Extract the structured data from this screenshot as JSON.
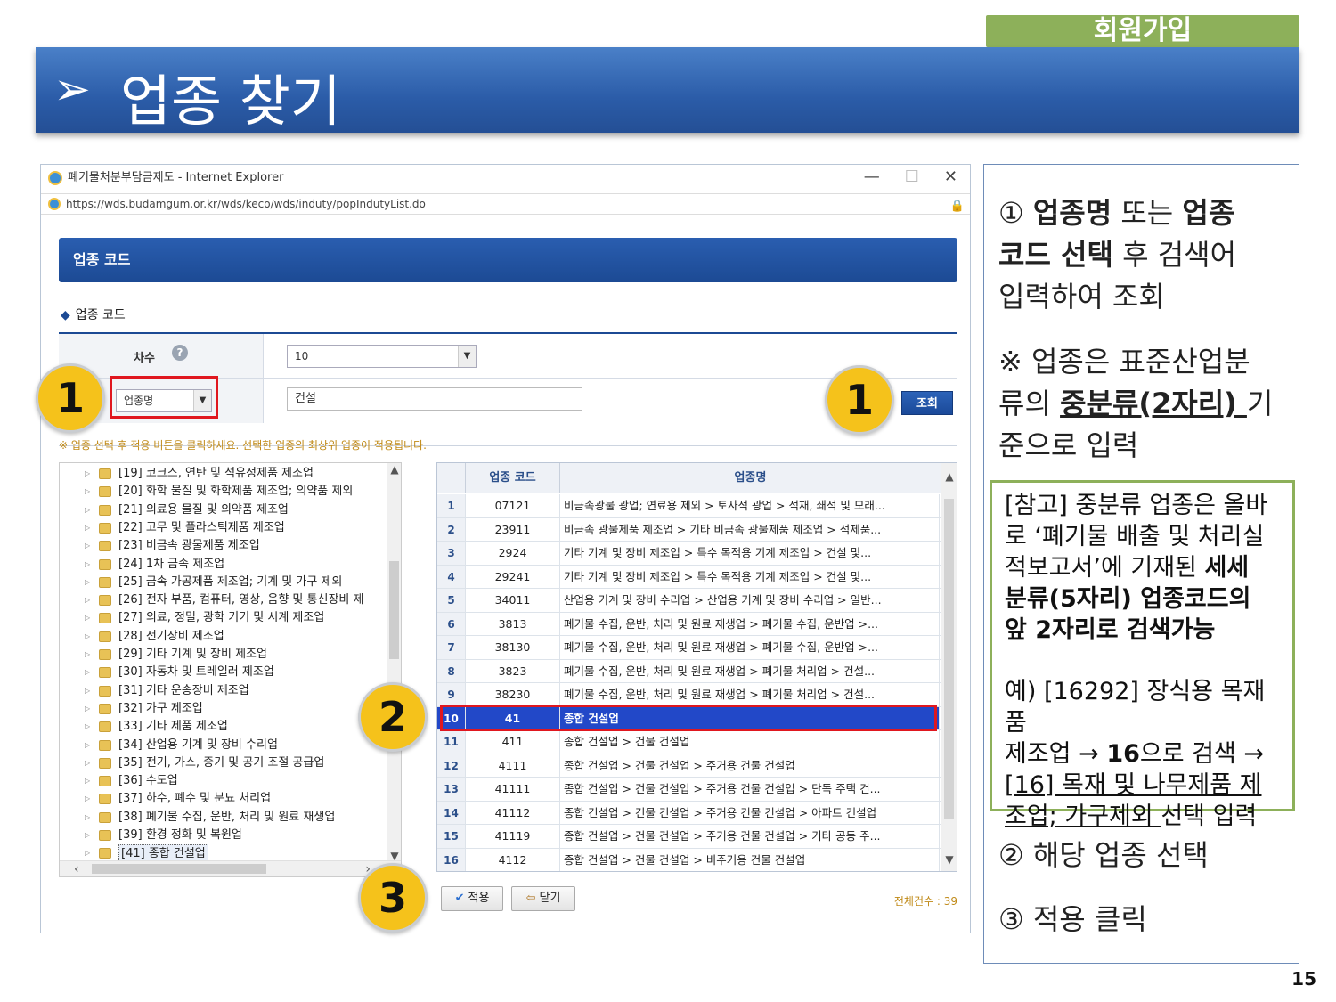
{
  "slide": {
    "badge": "회원가입",
    "arrow": "➢",
    "title": "업종 찾기",
    "page_number": "15"
  },
  "browser": {
    "window_title": "폐기물처분부담금제도 - Internet Explorer",
    "url": "https://wds.budamgum.or.kr/wds/keco/wds/induty/popIndutyList.do",
    "minimize": "—",
    "maximize": "☐",
    "close": "✕"
  },
  "popup": {
    "header": "업종 코드",
    "section_label": "업종 코드",
    "form": {
      "round_label": "차수",
      "round_value": "10",
      "type_select": "업종명",
      "search_value": "건설",
      "search_button": "조회"
    },
    "notice": "※ 업종 선택 후 적용 버튼을 클릭하세요. 선택한 업종의 최상위 업종이 적용됩니다.",
    "tree": [
      "[19] 코크스, 연탄 및 석유정제품 제조업",
      "[20] 화학 물질 및 화학제품 제조업; 의약품 제외",
      "[21] 의료용 물질 및 의약품 제조업",
      "[22] 고무 및 플라스틱제품 제조업",
      "[23] 비금속 광물제품 제조업",
      "[24] 1차 금속 제조업",
      "[25] 금속 가공제품 제조업; 기계 및 가구 제외",
      "[26] 전자 부품, 컴퓨터, 영상, 음향 및 통신장비 제",
      "[27] 의료, 정밀, 광학 기기 및 시계 제조업",
      "[28] 전기장비 제조업",
      "[29] 기타 기계 및 장비 제조업",
      "[30] 자동차 및 트레일러 제조업",
      "[31] 기타 운송장비 제조업",
      "[32] 가구 제조업",
      "[33] 기타 제품 제조업",
      "[34] 산업용 기계 및 장비 수리업",
      "[35] 전기, 가스, 증기 및 공기 조절 공급업",
      "[36] 수도업",
      "[37] 하수, 폐수 및 분뇨 처리업",
      "[38] 폐기물 수집, 운반, 처리 및 원료 재생업",
      "[39] 환경 정화 및 복원업",
      "[41] 종합 건설업"
    ],
    "grid": {
      "headers": [
        "",
        "업종 코드",
        "업종명"
      ],
      "rows": [
        {
          "no": "1",
          "code": "07121",
          "name": "비금속광물 광업; 연료용 제외 > 토사석 광업 > 석재, 쇄석 및 모래..."
        },
        {
          "no": "2",
          "code": "23911",
          "name": "비금속 광물제품 제조업 > 기타 비금속 광물제품 제조업 > 석제품..."
        },
        {
          "no": "3",
          "code": "2924",
          "name": "기타 기계 및 장비 제조업 > 특수 목적용 기계 제조업 > 건설 및..."
        },
        {
          "no": "4",
          "code": "29241",
          "name": "기타 기계 및 장비 제조업 > 특수 목적용 기계 제조업 > 건설 및..."
        },
        {
          "no": "5",
          "code": "34011",
          "name": "산업용 기계 및 장비 수리업 > 산업용 기계 및 장비 수리업 > 일반..."
        },
        {
          "no": "6",
          "code": "3813",
          "name": "폐기물 수집, 운반, 처리 및 원료 재생업 > 폐기물 수집, 운반업 >..."
        },
        {
          "no": "7",
          "code": "38130",
          "name": "폐기물 수집, 운반, 처리 및 원료 재생업 > 폐기물 수집, 운반업 >..."
        },
        {
          "no": "8",
          "code": "3823",
          "name": "폐기물 수집, 운반, 처리 및 원료 재생업 > 폐기물 처리업 > 건설..."
        },
        {
          "no": "9",
          "code": "38230",
          "name": "폐기물 수집, 운반, 처리 및 원료 재생업 > 폐기물 처리업 > 건설..."
        },
        {
          "no": "10",
          "code": "41",
          "name": "종합 건설업"
        },
        {
          "no": "11",
          "code": "411",
          "name": "종합 건설업 > 건물 건설업"
        },
        {
          "no": "12",
          "code": "4111",
          "name": "종합 건설업 > 건물 건설업 > 주거용 건물 건설업"
        },
        {
          "no": "13",
          "code": "41111",
          "name": "종합 건설업 > 건물 건설업 > 주거용 건물 건설업 > 단독 주택 건..."
        },
        {
          "no": "14",
          "code": "41112",
          "name": "종합 건설업 > 건물 건설업 > 주거용 건물 건설업 > 아파트 건설업"
        },
        {
          "no": "15",
          "code": "41119",
          "name": "종합 건설업 > 건물 건설업 > 주거용 건물 건설업 > 기타 공동 주..."
        },
        {
          "no": "16",
          "code": "4112",
          "name": "종합 건설업 > 건물 건설업 > 비주거용 건물 건설업"
        }
      ]
    },
    "apply_button": "적용",
    "close_button": "닫기",
    "total_count": "전체건수 : 39"
  },
  "markers": {
    "one": "1",
    "two": "2",
    "three": "3"
  },
  "panel": {
    "step1_num": "①",
    "step1_b1": "업종명",
    "step1_t1": " 또는 ",
    "step1_b2": "업종",
    "step1_b3": "코드 선택",
    "step1_t2": " 후 검색어",
    "step1_t3": "입력하여 조회",
    "note_l1": "※ 업종은 표준산업분",
    "note_l2a": "류의 ",
    "note_l2b": "중분류(2자리) ",
    "note_l2c": "기",
    "note_l3": "준으로 입력",
    "ref_l1": "[참고] 중분류 업종은 올바",
    "ref_l2": "로 ‘폐기물 배출 및 처리실",
    "ref_l3a": "적보고서’에 기재된 ",
    "ref_l3b": "세세",
    "ref_l4": "분류(5자리) 업종코드의",
    "ref_l5": "앞 2자리로 검색가능",
    "ref_ex1": "예) [16292] 장식용 목재품",
    "ref_ex2a": "제조업 → ",
    "ref_ex2b": "16",
    "ref_ex2c": "으로 검색 →",
    "ref_ex3": "[16] 목재 및 나무제품 제",
    "ref_ex4a": "조업; 가구제외 ",
    "ref_ex4b": "선택 입력",
    "step2": "② 해당 업종 선택",
    "step3": "③ 적용 클릭"
  }
}
